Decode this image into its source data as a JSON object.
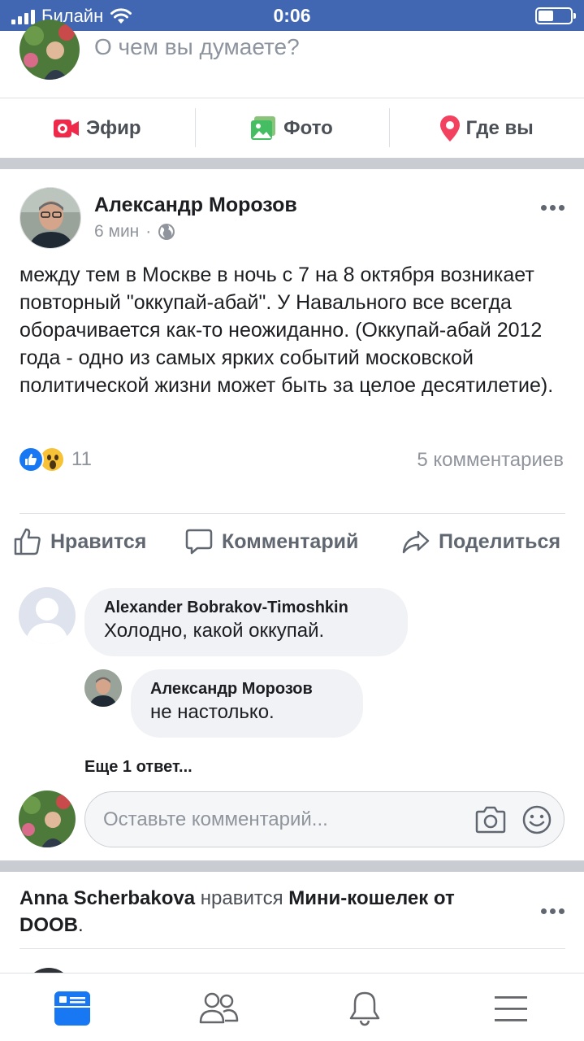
{
  "status_bar": {
    "carrier": "Билайн",
    "time": "0:06"
  },
  "composer": {
    "placeholder": "О чем вы думаете?",
    "actions": {
      "live": "Эфир",
      "photo": "Фото",
      "checkin": "Где вы"
    }
  },
  "post": {
    "author": "Александр Морозов",
    "time": "6 мин",
    "separator": "·",
    "text": "между тем в Москве в ночь с 7 на 8 октября возникает повторный \"оккупай-абай\". У Навального все всегда оборачивается как-то неожиданно. (Оккупай-абай 2012 года - одно из самых ярких событий московской политической жизни может быть за целое десятилетие).",
    "reactions_count": "11",
    "comments_count": "5 комментариев",
    "actions": {
      "like": "Нравится",
      "comment": "Комментарий",
      "share": "Поделиться"
    }
  },
  "comments": [
    {
      "author": "Alexander Bobrakov-Timoshkin",
      "text": "Холодно, какой оккупай."
    },
    {
      "author": "Александр Морозов",
      "text": "не настолько."
    }
  ],
  "more_replies": "Еще 1 ответ...",
  "comment_input_placeholder": "Оставьте комментарий...",
  "next_story": {
    "actor": "Anna Scherbakova",
    "verb": " нравится ",
    "object": "Мини-кошелек от DOOB",
    "end": "."
  },
  "colors": {
    "brand_blue": "#4267b2",
    "like_blue": "#1877f2",
    "wow_yellow": "#f7c236"
  }
}
